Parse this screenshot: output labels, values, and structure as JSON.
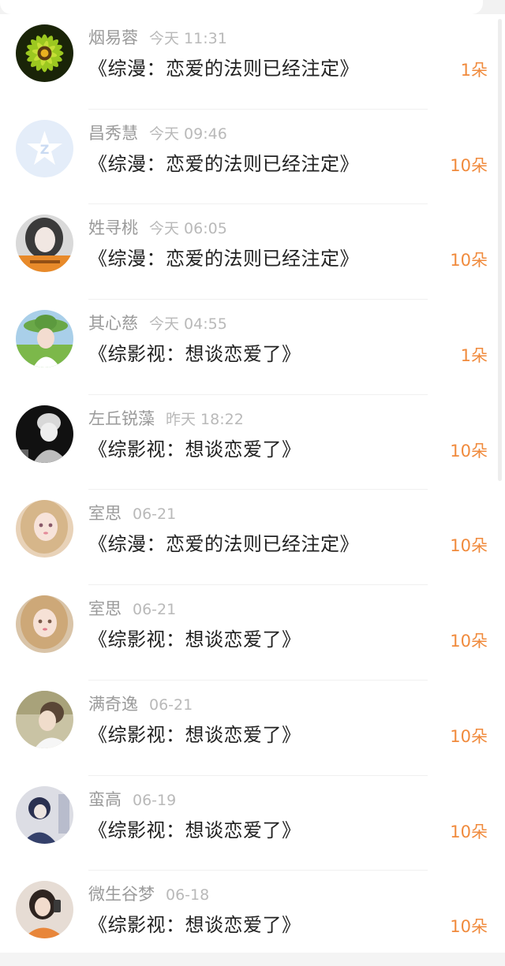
{
  "records": [
    {
      "name": "烟易蓉",
      "time": "今天 11:31",
      "title": "《综漫：恋爱的法则已经注定》",
      "amount": "1朵",
      "avatar_icon": "sunflower-avatar-icon"
    },
    {
      "name": "昌秀慧",
      "time": "今天 09:46",
      "title": "《综漫：恋爱的法则已经注定》",
      "amount": "10朵",
      "avatar_icon": "default-qq-avatar-icon"
    },
    {
      "name": "姓寻桃",
      "time": "今天 06:05",
      "title": "《综漫：恋爱的法则已经注定》",
      "amount": "10朵",
      "avatar_icon": "girl-avatar-icon"
    },
    {
      "name": "其心慈",
      "time": "今天 04:55",
      "title": "《综影视：想谈恋爱了》",
      "amount": "1朵",
      "avatar_icon": "girl-hat-avatar-icon"
    },
    {
      "name": "左丘锐藻",
      "time": "昨天 18:22",
      "title": "《综影视：想谈恋爱了》",
      "amount": "10朵",
      "avatar_icon": "bw-person-avatar-icon"
    },
    {
      "name": "室思",
      "time": "06-21",
      "title": "《综漫：恋爱的法则已经注定》",
      "amount": "10朵",
      "avatar_icon": "anime-girl-avatar-icon"
    },
    {
      "name": "室思",
      "time": "06-21",
      "title": "《综影视：想谈恋爱了》",
      "amount": "10朵",
      "avatar_icon": "anime-girl-avatar-icon"
    },
    {
      "name": "满奇逸",
      "time": "06-21",
      "title": "《综影视：想谈恋爱了》",
      "amount": "10朵",
      "avatar_icon": "woman-profile-avatar-icon"
    },
    {
      "name": "蛮高",
      "time": "06-19",
      "title": "《综影视：想谈恋爱了》",
      "amount": "10朵",
      "avatar_icon": "dark-figure-avatar-icon"
    },
    {
      "name": "微生谷梦",
      "time": "06-18",
      "title": "《综影视：想谈恋爱了》",
      "amount": "10朵",
      "avatar_icon": "selfie-girl-avatar-icon"
    }
  ],
  "colors": {
    "name": "#9a9a9a",
    "time": "#b9b9b9",
    "title": "#222222",
    "amount": "#f08a3c"
  }
}
